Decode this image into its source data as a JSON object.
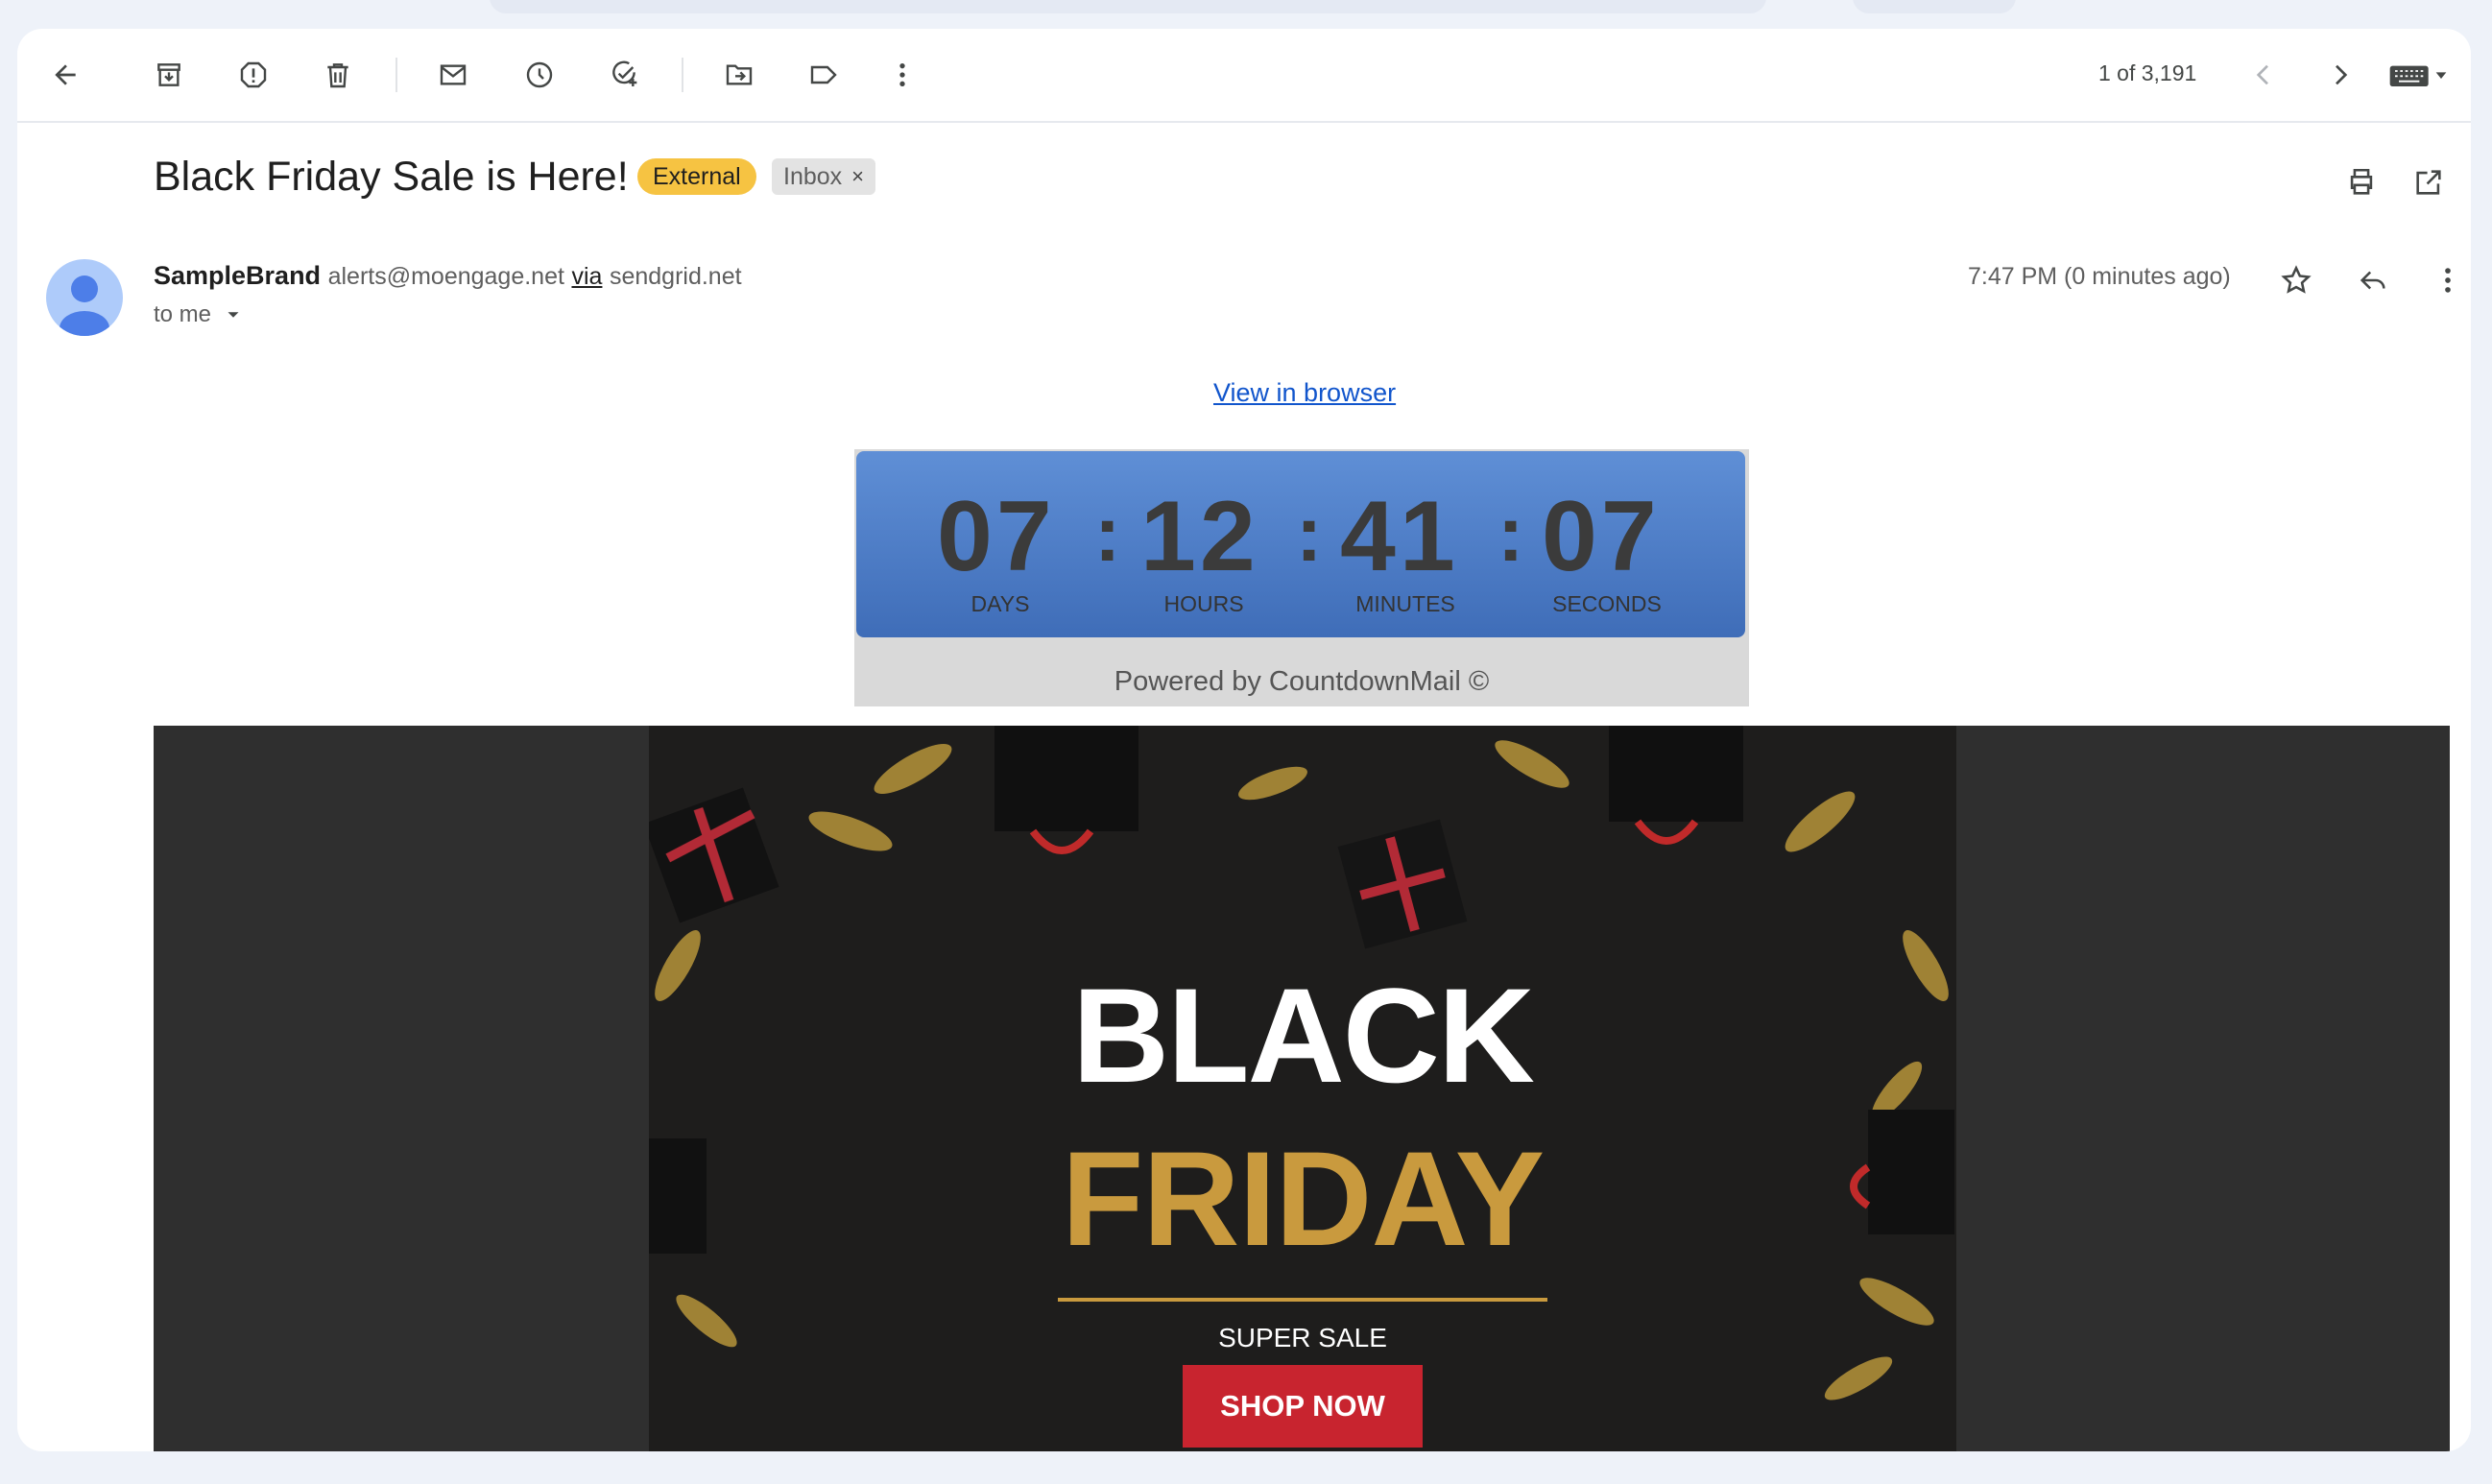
{
  "toolbar": {
    "back": "back-arrow-icon",
    "archive": "archive-icon",
    "report_spam": "report-spam-icon",
    "delete": "delete-icon",
    "mark_unread": "mail-icon",
    "snooze": "clock-icon",
    "add_task": "add-task-icon",
    "move_to": "move-to-folder-icon",
    "labels": "label-icon",
    "more": "more-vertical-icon",
    "counter": "1 of 3,191",
    "prev": "chevron-left-icon",
    "next": "chevron-right-icon",
    "input_tools": "keyboard-icon"
  },
  "email": {
    "subject": "Black Friday Sale is Here!",
    "badge_external": "External",
    "badge_inbox": "Inbox",
    "badge_inbox_close": "×",
    "sender_name": "SampleBrand",
    "sender_email": "alerts@moengage.net",
    "via_label": "via",
    "via_domain": "sendgrid.net",
    "recipient": "to me",
    "time": "7:47 PM (0 minutes ago)"
  },
  "body": {
    "view_in_browser": "View in browser",
    "countdown": {
      "days": "07",
      "hours": "12",
      "minutes": "41",
      "seconds": "07",
      "separator": ":",
      "labels": {
        "days": "DAYS",
        "hours": "HOURS",
        "minutes": "MINUTES",
        "seconds": "SECONDS"
      },
      "powered_by": "Powered by CountdownMail ©"
    },
    "banner": {
      "line1": "BLACK",
      "line2": "FRIDAY",
      "tagline": "SUPER SALE",
      "cta": "SHOP NOW"
    }
  },
  "colors": {
    "external_badge": "#f6c342",
    "link": "#1155cc",
    "countdown_bg": "#4f7fc8",
    "gold": "#c99a3e",
    "cta": "#c8242f",
    "banner_bg": "#2f2f2f",
    "hero_bg": "#1e1d1c"
  }
}
